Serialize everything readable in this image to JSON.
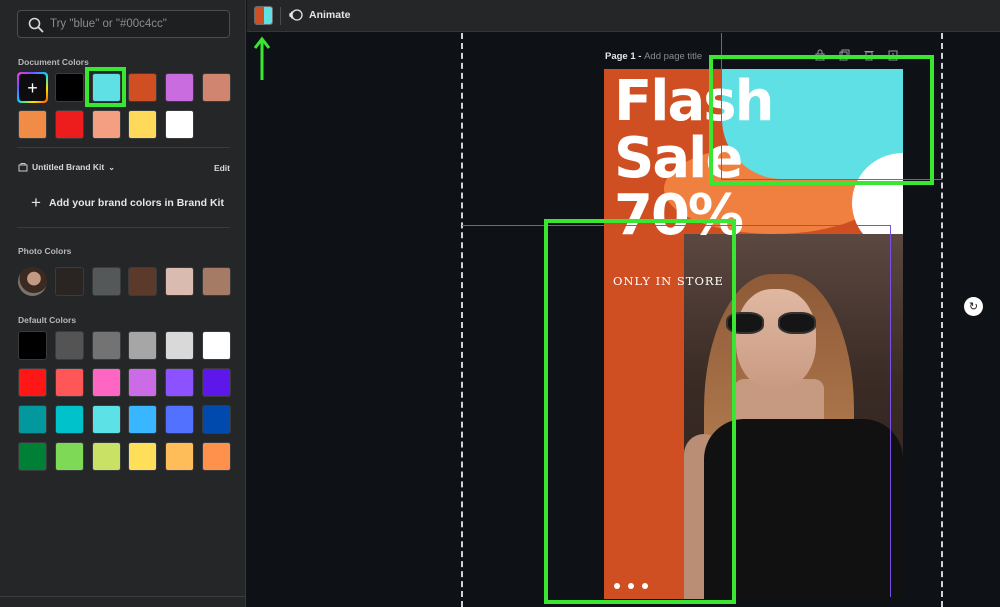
{
  "search": {
    "placeholder": "Try \"blue\" or \"#00c4cc\""
  },
  "document_colors": {
    "title": "Document Colors",
    "swatches": [
      "#000000",
      "#5ee0e4",
      "#cf4f22",
      "#c86ce0",
      "#d08570",
      "#f08c45",
      "#ee1d1d",
      "#f59f82",
      "#ffd95a",
      "#ffffff"
    ],
    "selected": "#5ee0e4"
  },
  "brand_kit": {
    "name": "Untitled Brand Kit",
    "edit_label": "Edit",
    "add_label": "Add your brand colors in Brand Kit"
  },
  "photo_colors": {
    "title": "Photo Colors",
    "swatches": [
      "#2a2522",
      "#555859",
      "#5b3a2c",
      "#d9bcaf",
      "#a57b65"
    ]
  },
  "default_colors": {
    "title": "Default Colors",
    "swatches": [
      "#000000",
      "#545454",
      "#737373",
      "#a6a6a6",
      "#d9d9d9",
      "#ffffff",
      "#ff1616",
      "#ff5757",
      "#ff66c4",
      "#cb6ce6",
      "#8c52ff",
      "#5e17eb",
      "#03989e",
      "#00c2cb",
      "#5ce1e6",
      "#38b6ff",
      "#5271ff",
      "#004aad",
      "#008037",
      "#7ed957",
      "#c9e265",
      "#ffde59",
      "#ffbd59",
      "#ff914d"
    ]
  },
  "topbar": {
    "animate_label": "Animate",
    "current_colors": [
      "#cf4f22",
      "#5ee0e4"
    ]
  },
  "page": {
    "number_label": "Page 1 - ",
    "title_placeholder": "Add page title"
  },
  "design": {
    "headline_lines": [
      "Flash",
      "Sale",
      "70%"
    ],
    "subtext": "ONLY IN STORE"
  }
}
